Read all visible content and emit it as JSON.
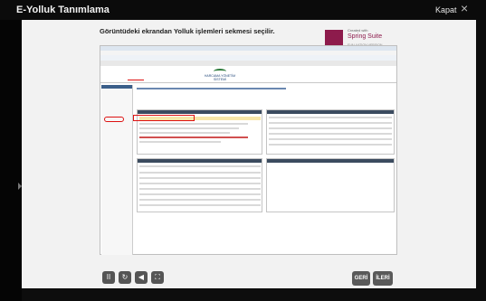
{
  "window": {
    "title": "E-Yolluk Tanımlama",
    "close_label": "Kapat",
    "close_icon": "×"
  },
  "slide": {
    "caption": "Görüntüdeki ekrandan Yolluk işlemleri sekmesi seçilir."
  },
  "brand": {
    "top": "Created with",
    "name": "Spring Suite",
    "sub": "EVALUATION VERSION"
  },
  "screenshot": {
    "header_logo_text": "HARCAMA YÖNETİM SİSTEMİ"
  },
  "controls": {
    "pause": "II",
    "replay": "↻",
    "volume": "◀",
    "settings": "⛶",
    "back_label": "GERİ",
    "next_label": "İLERİ"
  },
  "colors": {
    "accent_red": "#dd1111",
    "header_dark": "#3b4b5f",
    "brand": "#8d1b4c"
  }
}
